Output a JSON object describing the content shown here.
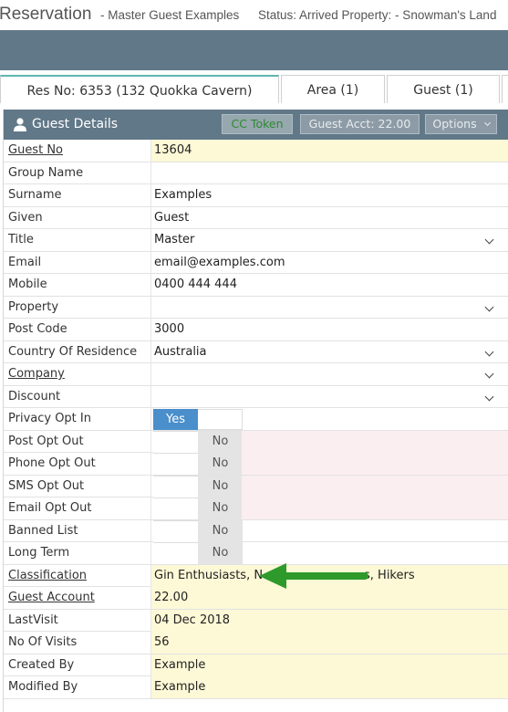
{
  "title": {
    "main": "Reservation",
    "sub1": "- Master Guest Examples",
    "sub2": "Status: Arrived Property: - Snowman's Land"
  },
  "tabs": [
    {
      "label": "Res No: 6353 (132 Quokka Cavern)",
      "active": true
    },
    {
      "label": "Area (1)",
      "active": false
    },
    {
      "label": "Guest (1)",
      "active": false
    }
  ],
  "panel": {
    "title": "Guest Details",
    "icon": "user-icon",
    "buttons": {
      "cc_token": "CC Token",
      "guest_acct": "Guest Acct: 22.00",
      "options": "Options"
    }
  },
  "fields": {
    "guest_no": {
      "label": "Guest No",
      "value": "13604"
    },
    "group_name": {
      "label": "Group Name",
      "value": ""
    },
    "surname": {
      "label": "Surname",
      "value": "Examples"
    },
    "given": {
      "label": "Given",
      "value": "Guest"
    },
    "title": {
      "label": "Title",
      "value": "Master"
    },
    "email": {
      "label": "Email",
      "value": "email@examples.com"
    },
    "mobile": {
      "label": "Mobile",
      "value": "0400 444 444"
    },
    "property": {
      "label": "Property",
      "value": ""
    },
    "post_code": {
      "label": "Post Code",
      "value": "3000"
    },
    "country": {
      "label": "Country Of Residence",
      "value": "Australia"
    },
    "company": {
      "label": "Company",
      "value": ""
    },
    "discount": {
      "label": "Discount",
      "value": ""
    },
    "privacy_opt_in": {
      "label": "Privacy Opt In",
      "value": "Yes"
    },
    "post_opt_out": {
      "label": "Post Opt Out",
      "value": "No"
    },
    "phone_opt_out": {
      "label": "Phone Opt Out",
      "value": "No"
    },
    "sms_opt_out": {
      "label": "SMS Opt Out",
      "value": "No"
    },
    "email_opt_out": {
      "label": "Email Opt Out",
      "value": "No"
    },
    "banned_list": {
      "label": "Banned List",
      "value": "No"
    },
    "long_term": {
      "label": "Long Term",
      "value": "No"
    },
    "classification": {
      "label": "Classification",
      "value_start": "Gin Enthusiasts, N",
      "value_end": "s, Hikers"
    },
    "guest_account": {
      "label": "Guest Account",
      "value": "22.00"
    },
    "last_visit": {
      "label": "LastVisit",
      "value": "04 Dec 2018"
    },
    "no_of_visits": {
      "label": "No Of Visits",
      "value": "56"
    },
    "created_by": {
      "label": "Created By",
      "value": "Example"
    },
    "modified_by": {
      "label": "Modified By",
      "value": "Example"
    }
  },
  "colors": {
    "header_bg": "#617888",
    "readonly_bg": "#fdf8d6",
    "toggle_on": "#4a8ecb",
    "opt_out_bg": "#fbeef0",
    "arrow": "#2e9a2c"
  }
}
